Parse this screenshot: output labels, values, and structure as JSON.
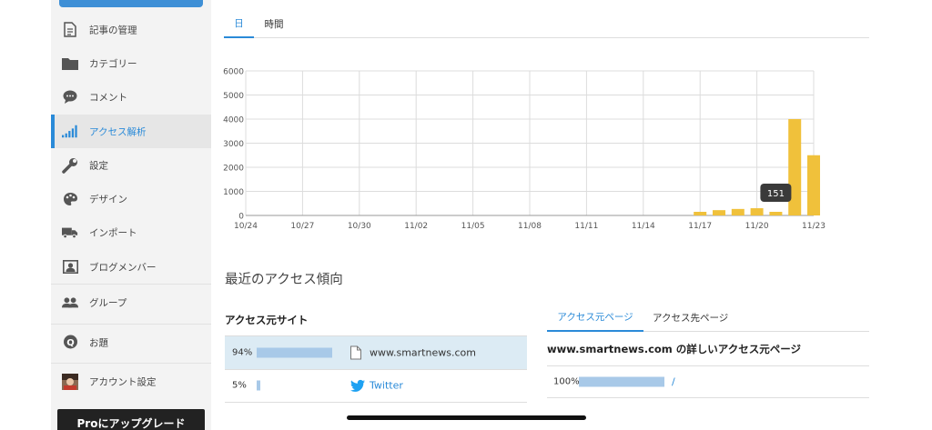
{
  "sidebar": {
    "items": [
      {
        "label": "記事の管理",
        "icon": "document-icon"
      },
      {
        "label": "カテゴリー",
        "icon": "folder-icon"
      },
      {
        "label": "コメント",
        "icon": "comment-icon"
      },
      {
        "label": "アクセス解析",
        "icon": "signal-bars-icon",
        "active": true
      },
      {
        "label": "設定",
        "icon": "wrench-icon"
      },
      {
        "label": "デザイン",
        "icon": "palette-icon"
      },
      {
        "label": "インポート",
        "icon": "truck-icon"
      },
      {
        "label": "ブログメンバー",
        "icon": "member-card-icon"
      },
      {
        "label": "グループ",
        "icon": "group-icon"
      },
      {
        "label": "お題",
        "icon": "question-icon"
      },
      {
        "label": "アカウント設定",
        "icon": "avatar-icon"
      }
    ],
    "pro_button": "Proにアップグレード"
  },
  "tabs": [
    {
      "label": "日",
      "active": true
    },
    {
      "label": "時間",
      "active": false
    }
  ],
  "chart_data": {
    "type": "bar",
    "x_ticks": [
      "10/24",
      "10/27",
      "10/30",
      "11/02",
      "11/05",
      "11/08",
      "11/11",
      "11/14",
      "11/17",
      "11/20",
      "11/23"
    ],
    "categories": [
      "11/17",
      "11/18",
      "11/19",
      "11/20",
      "11/21",
      "11/22",
      "11/23"
    ],
    "values": [
      151,
      220,
      270,
      300,
      151,
      4000,
      2500
    ],
    "y_ticks": [
      0,
      1000,
      2000,
      3000,
      4000,
      5000,
      6000
    ],
    "ylim": [
      0,
      6000
    ],
    "tooltip": "151",
    "bar_color": "#f0c13b",
    "grid": true
  },
  "trend_title": "最近のアクセス傾向",
  "source_sites": {
    "title": "アクセス元サイト",
    "rows": [
      {
        "percent": "94%",
        "fraction": 0.94,
        "site": "www.smartnews.com",
        "icon": "page-icon"
      },
      {
        "percent": "5%",
        "fraction": 0.05,
        "site": "Twitter",
        "icon": "twitter-bird-icon"
      }
    ]
  },
  "page_tabs": [
    {
      "label": "アクセス元ページ",
      "active": true
    },
    {
      "label": "アクセス先ページ",
      "active": false
    }
  ],
  "detail": {
    "title": "www.smartnews.com の詳しいアクセス元ページ",
    "rows": [
      {
        "percent": "100%",
        "fraction": 1.0,
        "link": "/"
      }
    ]
  },
  "colors": {
    "accent": "#2a8ad8",
    "bar_blue": "#a8c9e8",
    "twitter": "#1da1f2"
  }
}
